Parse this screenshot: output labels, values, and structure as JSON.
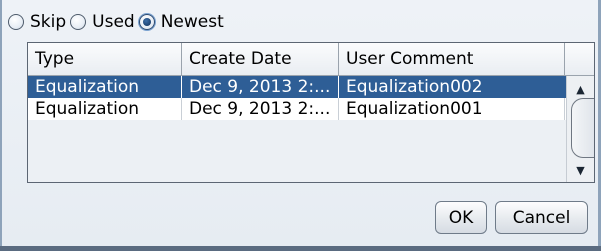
{
  "radio_group": {
    "options": [
      {
        "label": "Skip",
        "selected": false
      },
      {
        "label": "Used",
        "selected": false
      },
      {
        "label": "Newest",
        "selected": true
      }
    ]
  },
  "table": {
    "columns": [
      "Type",
      "Create Date",
      "User Comment"
    ],
    "rows": [
      {
        "type": "Equalization",
        "create_date": "Dec 9, 2013 2:...",
        "user_comment": "Equalization002",
        "selected": true
      },
      {
        "type": "Equalization",
        "create_date": "Dec 9, 2013 2:...",
        "user_comment": "Equalization001",
        "selected": false
      }
    ],
    "scrollbar": {
      "up_icon": "▲",
      "down_icon": "▼"
    }
  },
  "buttons": {
    "ok_label": "OK",
    "cancel_label": "Cancel"
  },
  "colors": {
    "selection": "#2e5e96",
    "background": "#e9eef4"
  }
}
